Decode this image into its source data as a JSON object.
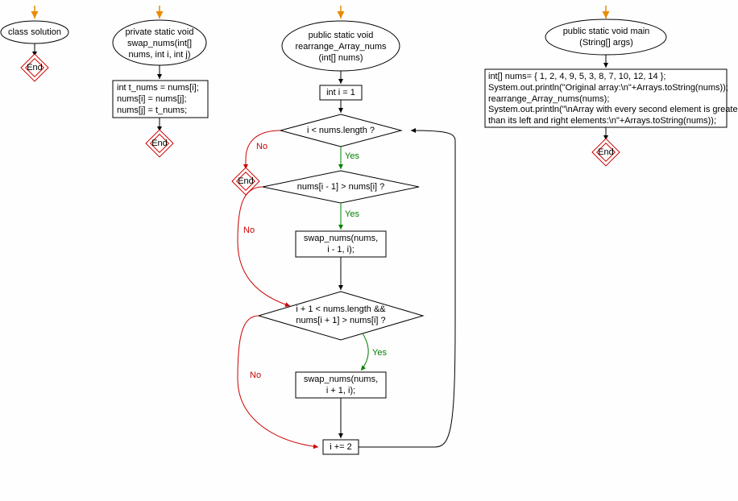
{
  "col1": {
    "start_label": "class solution",
    "end_label": "End"
  },
  "col2": {
    "start_label": "private static void\nswap_nums(int[]\nnums, int i, int j)",
    "proc": "int t_nums = nums[i];\nnums[i] = nums[j];\nnums[j] = t_nums;",
    "end_label": "End"
  },
  "col3": {
    "start_label": "public static void\nrearrange_Array_nums\n(int[] nums)",
    "init": "int i = 1",
    "cond1": "i < nums.length ?",
    "cond2": "nums[i - 1] > nums[i] ?",
    "swap1": "swap_nums(nums,\ni - 1, i);",
    "cond3": "i + 1 < nums.length &&\nnums[i + 1] > nums[i] ?",
    "swap2": "swap_nums(nums,\ni + 1, i);",
    "inc": "i += 2",
    "end_label": "End",
    "yes": "Yes",
    "no": "No"
  },
  "col4": {
    "start_label": "public static void main\n(String[] args)",
    "proc": "int[] nums= { 1, 2, 4, 9, 5, 3, 8, 7, 10, 12, 14 };\nSystem.out.println(\"Original array:\\n\"+Arrays.toString(nums));\nrearrange_Array_nums(nums);\nSystem.out.println(\"\\nArray with every second element is greater\nthan its left and right elements:\\n\"+Arrays.toString(nums));",
    "end_label": "End"
  }
}
